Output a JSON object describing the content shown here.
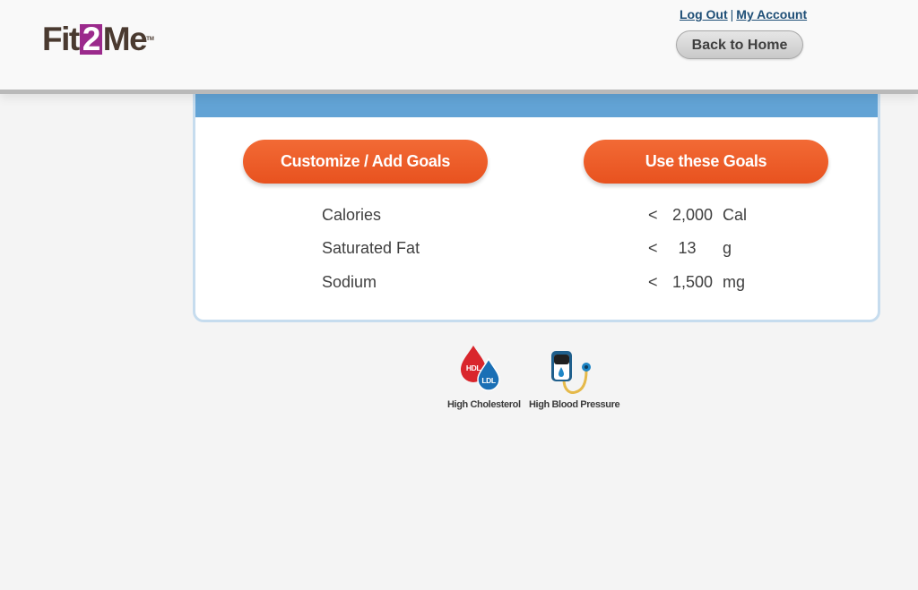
{
  "header": {
    "logo_left": "Fit",
    "logo_mid": "2",
    "logo_right": "Me",
    "logo_tm": "TM",
    "logout_label": "Log Out",
    "separator": "|",
    "account_label": "My Account",
    "home_button_label": "Back to Home"
  },
  "goals": {
    "customize_button_label": "Customize / Add Goals",
    "use_button_label": "Use these Goals",
    "rows": [
      {
        "label": "Calories",
        "comparator": "<",
        "value": "2,000",
        "unit": "Cal"
      },
      {
        "label": "Saturated Fat",
        "comparator": "<",
        "value": "13",
        "unit": "g"
      },
      {
        "label": "Sodium",
        "comparator": "<",
        "value": "1,500",
        "unit": "mg"
      }
    ]
  },
  "conditions": [
    {
      "label": "High Cholesterol",
      "icon": "cholesterol-drops-icon",
      "badges": [
        "HDL",
        "LDL"
      ]
    },
    {
      "label": "High Blood Pressure",
      "icon": "blood-pressure-cuff-icon"
    }
  ],
  "colors": {
    "accent_orange": "#e8521f",
    "band_blue": "#62a3d5",
    "logo_purple": "#9b2a8c",
    "logo_brown": "#4a3a30"
  }
}
